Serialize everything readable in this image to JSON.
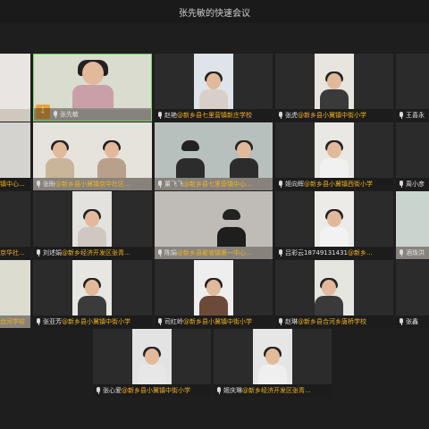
{
  "window": {
    "title": "张先敏的快速会议"
  },
  "tiles": [
    {
      "name": "",
      "org": ""
    },
    {
      "name": "张先敏",
      "org": ""
    },
    {
      "name": "赵艳",
      "org": "@新乡县七里营镇新庄学校"
    },
    {
      "name": "张虎",
      "org": "@新乡县小冀镇中街小学"
    },
    {
      "name": "王喜永",
      "org": ""
    },
    {
      "name": "张盼",
      "org": "@新乡县小冀镇京华社区..."
    },
    {
      "name": "董飞飞",
      "org": "@新乡县七里营镇中心..."
    },
    {
      "name": "姬向辉",
      "org": "@新乡县小冀镇西街小学"
    },
    {
      "name": "周小彦",
      "org": ""
    },
    {
      "name": "刘述娟",
      "org": "@新乡经济开发区张青..."
    },
    {
      "name": "陈娟",
      "org": "@新乡县翟坡镇第一中心..."
    },
    {
      "name": "吕彩云18749131431",
      "org": "@新乡..."
    },
    {
      "name": "酒珠洪",
      "org": ""
    },
    {
      "name": "张亚芳",
      "org": "@新乡县小冀镇中街小学"
    },
    {
      "name": "司红岭",
      "org": "@新乡县小冀镇中街小学"
    },
    {
      "name": "赵琳",
      "org": "@新乡县合河乡唐桥学校"
    },
    {
      "name": "张鑫",
      "org": ""
    },
    {
      "name": "张心爱",
      "org": "@新乡县小冀镇中街小学"
    },
    {
      "name": "姬庆琳",
      "org": "@新乡经济开发区张青..."
    }
  ],
  "partial_labels": {
    "row2": "镇中心...",
    "row3": "京华社...",
    "row4": "合河学校"
  }
}
